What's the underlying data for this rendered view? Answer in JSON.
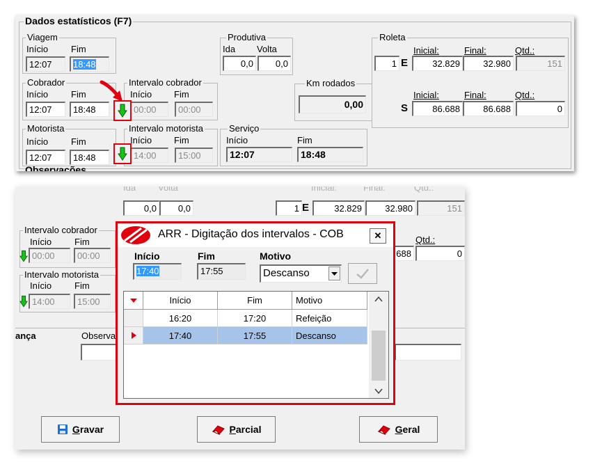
{
  "stats": {
    "title": "Dados estatísticos (F7)",
    "viagem": {
      "legend": "Viagem",
      "inicio_label": "Início",
      "fim_label": "Fim",
      "inicio": "12:07",
      "fim": "18:48"
    },
    "cobrador": {
      "legend": "Cobrador",
      "inicio_label": "Início",
      "fim_label": "Fim",
      "inicio": "12:07",
      "fim": "18:48"
    },
    "motorista": {
      "legend": "Motorista",
      "inicio_label": "Início",
      "fim_label": "Fim",
      "inicio": "12:07",
      "fim": "18:48"
    },
    "intervalo_cobrador": {
      "legend": "Intervalo cobrador",
      "inicio_label": "Início",
      "fim_label": "Fim",
      "inicio": "00:00",
      "fim": "00:00"
    },
    "intervalo_motorista": {
      "legend": "Intervalo motorista",
      "inicio_label": "Início",
      "fim_label": "Fim",
      "inicio": "14:00",
      "fim": "15:00"
    },
    "produtiva": {
      "legend": "Produtiva",
      "ida_label": "Ida",
      "volta_label": "Volta",
      "ida": "0,0",
      "volta": "0,0"
    },
    "km_rodados": {
      "legend": "Km rodados",
      "value": "0,00"
    },
    "servico": {
      "legend": "Serviço",
      "inicio_label": "Início",
      "fim_label": "Fim",
      "inicio": "12:07",
      "fim": "18:48"
    },
    "roleta": {
      "legend": "Roleta",
      "inicial_label": "Inicial:",
      "final_label": "Final:",
      "qtd_label": "Qtd.:",
      "number": "1",
      "e": {
        "letter": "E",
        "inicial": "32.829",
        "final": "32.980",
        "qtd": "151"
      },
      "s": {
        "letter": "S",
        "inicial": "86.688",
        "final": "86.688",
        "qtd": "0"
      }
    },
    "observacoes_partial": "Observações"
  },
  "lower": {
    "ida_label": "Ida",
    "volta_label": "Volta",
    "ida": "0,0",
    "volta": "0,0",
    "roleta_number": "1",
    "roleta_letter": "E",
    "inicial_label": "Inicial:",
    "final_label": "Final:",
    "qtd_label": "Qtd.:",
    "roleta_inicial": "32.829",
    "roleta_final": "32.980",
    "roleta_qtd": "151",
    "qtd_label2": "Qtd.:",
    "roleta_final2_partial": "688",
    "roleta_qtd2": "0",
    "intervalo_cobrador": {
      "legend": "Intervalo cobrador",
      "inicio_label": "Início",
      "fim_label": "Fim",
      "inicio": "00:00",
      "fim": "00:00"
    },
    "intervalo_motorista": {
      "legend": "Intervalo motorista",
      "inicio_label": "Início",
      "fim_label": "Fim",
      "inicio": "14:00",
      "fim": "15:00"
    },
    "left_partial_label": "ança",
    "obs_partial_label": "Observa"
  },
  "dialog": {
    "title": "ARR - Digitação dos intervalos - COB",
    "close": "✕",
    "inicio_label": "Início",
    "fim_label": "Fim",
    "motivo_label": "Motivo",
    "inicio": "17:40",
    "fim": "17:55",
    "motivo": "Descanso",
    "columns": [
      "Início",
      "Fim",
      "Motivo"
    ],
    "rows": [
      {
        "inicio": "16:20",
        "fim": "17:20",
        "motivo": "Refeição"
      },
      {
        "inicio": "17:40",
        "fim": "17:55",
        "motivo": "Descanso"
      }
    ]
  },
  "buttons": {
    "gravar_pre": "",
    "gravar_key": "G",
    "gravar_post": "ravar",
    "parcial_pre": "",
    "parcial_key": "P",
    "parcial_post": "arcial",
    "geral_pre": "",
    "geral_key": "G",
    "geral_post": "eral"
  },
  "colors": {
    "highlight": "#e0000e",
    "selected_row": "#a6c4ea",
    "arrow": "#18c21a",
    "selection": "#3399ff"
  },
  "icons": [
    "down-arrow-icon",
    "pointer-arrow-icon",
    "close-icon",
    "dropdown-arrow-icon",
    "check-icon",
    "save-icon",
    "eraser-icon",
    "app-logo-icon",
    "row-indicator-icon",
    "scroll-up-icon",
    "scroll-down-icon"
  ]
}
